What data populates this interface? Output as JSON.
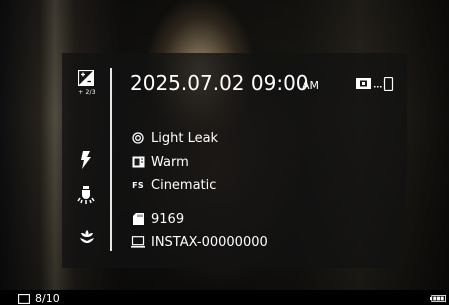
{
  "header": {
    "date": "2025.07.02",
    "time": "09:00",
    "ampm": "AM"
  },
  "left_controls": {
    "exposure_label": "+ 2/3",
    "icons": [
      "exposure-compensation-icon",
      "flash-icon",
      "self-timer-lamp-icon",
      "macro-flower-icon"
    ]
  },
  "info": {
    "effect": "Light Leak",
    "white_balance": "Warm",
    "film_style": "Cinematic",
    "film_style_tag": "FS",
    "image_number": "9169",
    "device_name": "INSTAX-00000000"
  },
  "status": {
    "frame_counter": "8/10",
    "battery_icon": "battery-full-icon"
  }
}
